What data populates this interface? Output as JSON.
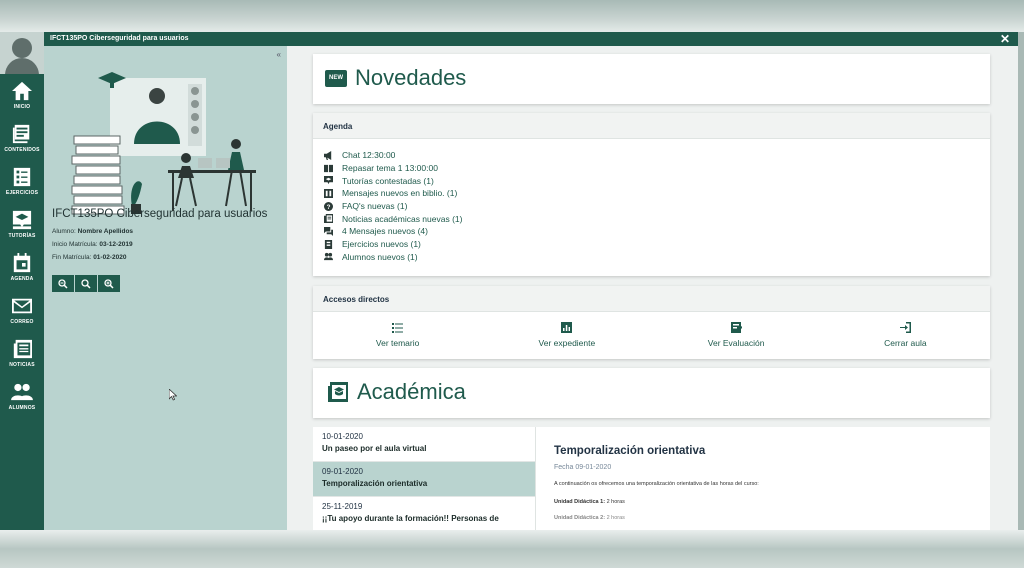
{
  "window": {
    "title": "IFCT135PO Ciberseguridad para usuarios",
    "close_label": "✕"
  },
  "rail": [
    {
      "label": "INICIO",
      "icon": "home-icon"
    },
    {
      "label": "CONTENIDOS",
      "icon": "contents-icon"
    },
    {
      "label": "EJERCICIOS",
      "icon": "exercises-icon"
    },
    {
      "label": "TUTORÍAS",
      "icon": "tutorials-icon"
    },
    {
      "label": "AGENDA",
      "icon": "calendar-icon"
    },
    {
      "label": "CORREO",
      "icon": "mail-icon"
    },
    {
      "label": "NOTICIAS",
      "icon": "news-icon"
    },
    {
      "label": "ALUMNOS",
      "icon": "students-icon"
    }
  ],
  "left_panel": {
    "collapse_label": "«",
    "course_title": "IFCT135PO Ciberseguridad para usuarios",
    "student_label": "Alumno:",
    "student_name": "Nombre Apellidos",
    "start_label": "Inicio Matrícula:",
    "start_date": "03-12-2019",
    "end_label": "Fin Matrícula:",
    "end_date": "01-02-2020"
  },
  "novedades": {
    "title": "Novedades",
    "badge": "NEW"
  },
  "agenda": {
    "title": "Agenda",
    "items": [
      {
        "text": "Chat   12:30:00",
        "icon": "megaphone-icon"
      },
      {
        "text": "Repasar tema 1   13:00:00",
        "icon": "book-icon"
      },
      {
        "text": "Tutorías contestadas (1)",
        "icon": "tutor-icon"
      },
      {
        "text": "Mensajes nuevos en biblio. (1)",
        "icon": "library-icon"
      },
      {
        "text": "FAQ's nuevas (1)",
        "icon": "question-icon"
      },
      {
        "text": "Noticias académicas nuevas (1)",
        "icon": "news-icon"
      },
      {
        "text": "4 Mensajes nuevos (4)",
        "icon": "messages-icon"
      },
      {
        "text": "Ejercicios nuevos (1)",
        "icon": "exercise-icon"
      },
      {
        "text": "Alumnos nuevos (1)",
        "icon": "users-icon"
      }
    ]
  },
  "shortcuts": {
    "title": "Accesos directos",
    "items": [
      {
        "label": "Ver temario",
        "icon": "list-icon"
      },
      {
        "label": "Ver expediente",
        "icon": "chart-icon"
      },
      {
        "label": "Ver Evaluación",
        "icon": "evaluation-icon"
      },
      {
        "label": "Cerrar aula",
        "icon": "exit-icon"
      }
    ]
  },
  "academica": {
    "title": "Académica",
    "news": [
      {
        "date": "10-01-2020",
        "title": "Un paseo por el aula virtual"
      },
      {
        "date": "09-01-2020",
        "title": "Temporalización orientativa"
      },
      {
        "date": "25-11-2019",
        "title": "¡¡Tu apoyo durante la formación!! Personas de"
      }
    ],
    "selected_index": 1,
    "detail": {
      "title": "Temporalización orientativa",
      "date": "Fecha 09-01-2020",
      "para": "A continuación os ofrecemos una temporalización orientativa de las horas del curso:",
      "ud1_label": "Unidad Didáctica 1:",
      "ud1_value": "2 horas",
      "ud2_label": "Unidad Didáctica 2:",
      "ud2_value": "2 horas"
    }
  },
  "colors": {
    "primary": "#1f5a4c",
    "panel": "#b9d3cf"
  }
}
